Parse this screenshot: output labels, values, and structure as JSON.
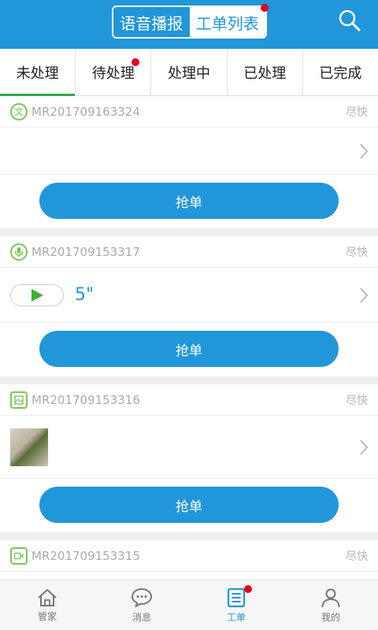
{
  "colors": {
    "primary": "#2196d9",
    "tab_indicator": "#2ea84a",
    "badge": "#e0001b",
    "type_icon": "#7dc35b"
  },
  "header": {
    "segments": [
      {
        "label": "语音播报",
        "active": false
      },
      {
        "label": "工单列表",
        "active": true,
        "badge": true
      }
    ],
    "search_icon": "search-icon"
  },
  "tabs": [
    {
      "label": "未处理",
      "active": true
    },
    {
      "label": "待处理",
      "badge": true
    },
    {
      "label": "处理中"
    },
    {
      "label": "已处理"
    },
    {
      "label": "已完成"
    }
  ],
  "orders": [
    {
      "type_icon": "text-icon",
      "type_char": "文",
      "order_no": "MR201709163324",
      "urgency": "尽快",
      "content": "text",
      "action": "抢单"
    },
    {
      "type_icon": "mic-icon",
      "order_no": "MR201709153317",
      "urgency": "尽快",
      "content": "audio",
      "duration": "5\"",
      "action": "抢单"
    },
    {
      "type_icon": "image-icon",
      "order_no": "MR201709153316",
      "urgency": "尽快",
      "content": "image",
      "action": "抢单"
    },
    {
      "type_icon": "video-icon",
      "order_no": "MR201709153315",
      "urgency": "尽快",
      "content": "video"
    }
  ],
  "bottom_nav": [
    {
      "label": "管家",
      "icon": "home-icon"
    },
    {
      "label": "消息",
      "icon": "message-icon"
    },
    {
      "label": "工单",
      "icon": "workorder-icon",
      "active": true,
      "badge": true
    },
    {
      "label": "我的",
      "icon": "profile-icon"
    }
  ]
}
